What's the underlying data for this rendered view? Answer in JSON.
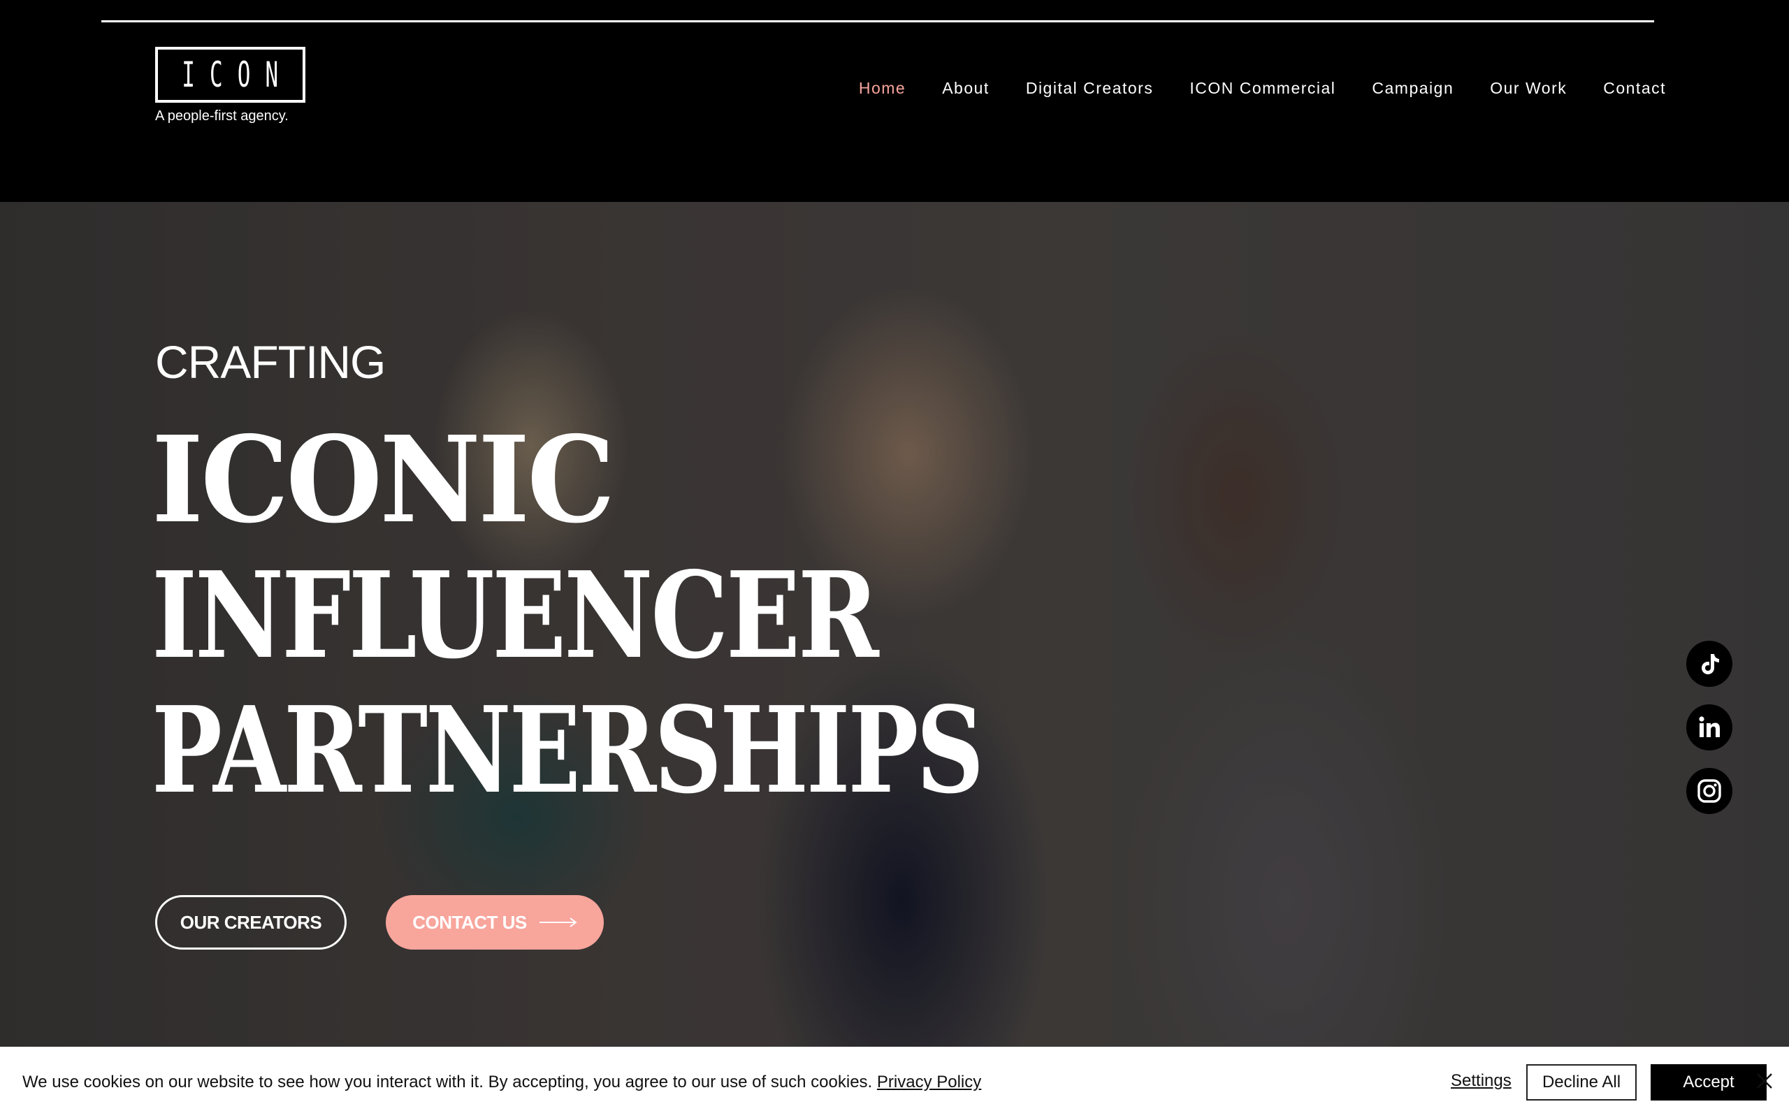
{
  "header": {
    "logo_text": "ICON",
    "logo_tagline": "A people-first agency.",
    "nav": [
      {
        "label": "Home",
        "active": true
      },
      {
        "label": "About"
      },
      {
        "label": "Digital Creators"
      },
      {
        "label": "ICON Commercial"
      },
      {
        "label": "Campaign"
      },
      {
        "label": "Our Work"
      },
      {
        "label": "Contact"
      }
    ]
  },
  "hero": {
    "kicker": "CRAFTING",
    "headline": [
      "ICONIC",
      "INFLUENCER",
      "PARTNERSHIPS"
    ],
    "buttons": {
      "creators": "OUR CREATORS",
      "contact": "CONTACT US"
    },
    "socials": [
      "tiktok-icon",
      "linkedin-icon",
      "instagram-icon"
    ]
  },
  "cookie": {
    "message": "We use cookies on our website to see how you interact with it. By accepting, you agree to our use of such cookies.",
    "policy_link": "Privacy Policy",
    "settings": "Settings",
    "decline": "Decline All",
    "accept": "Accept"
  },
  "colors": {
    "accent": "#f8a59c",
    "header_bg": "#000000",
    "cookie_bg": "#ffffff"
  }
}
